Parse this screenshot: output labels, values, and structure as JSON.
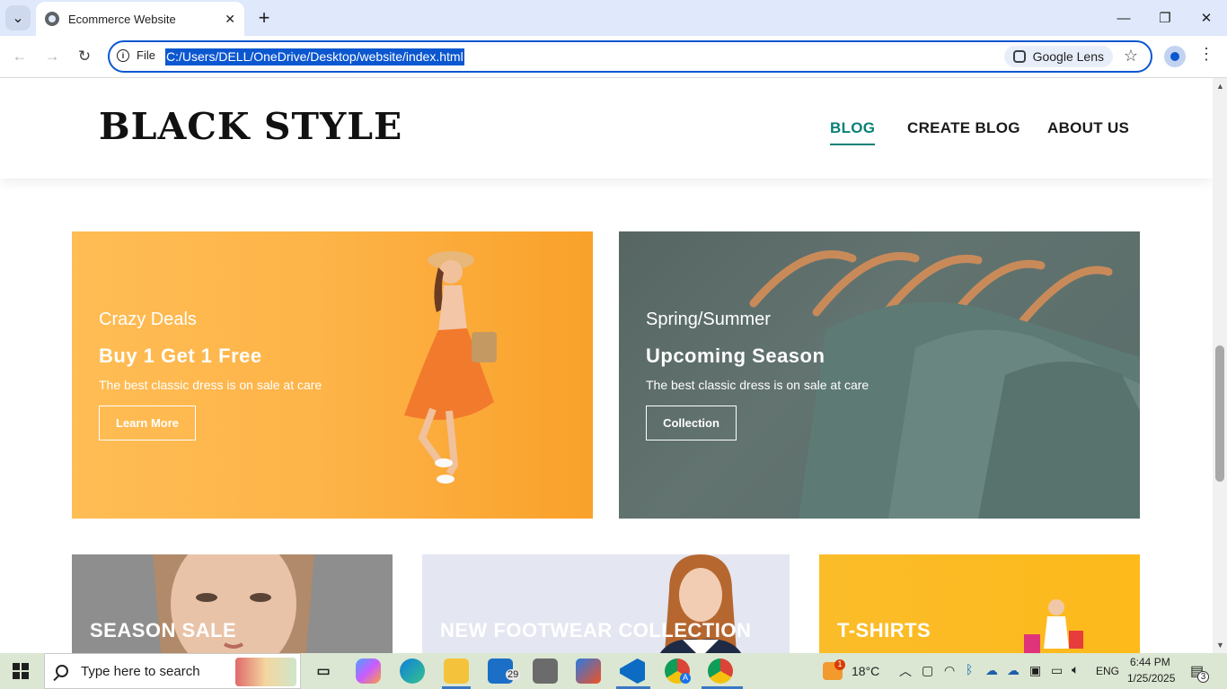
{
  "browser": {
    "tab_title": "Ecommerce Website",
    "url": "C:/Users/DELL/OneDrive/Desktop/website/index.html",
    "site_info_label": "File",
    "lens_label": "Google Lens",
    "close_tab_glyph": "✕",
    "new_tab_glyph": "+",
    "minimize_glyph": "—",
    "restore_glyph": "❐",
    "close_window_glyph": "✕",
    "back_glyph": "←",
    "forward_glyph": "→",
    "reload_glyph": "↻",
    "star_glyph": "☆",
    "menu_glyph": "⋮",
    "tab_list_glyph": "⌄"
  },
  "site": {
    "logo": "BLACK STYLE",
    "nav": [
      {
        "label": "BLOG",
        "active": true
      },
      {
        "label": "CREATE BLOG",
        "active": false
      },
      {
        "label": "ABOUT US",
        "active": false
      }
    ],
    "accent_color": "#088178"
  },
  "banners": [
    {
      "kicker": "Crazy Deals",
      "headline": "Buy 1 Get 1 Free",
      "desc": "The best classic dress is on sale at care",
      "button": "Learn More"
    },
    {
      "kicker": "Spring/Summer",
      "headline": "Upcoming Season",
      "desc": "The best classic dress is on sale at care",
      "button": "Collection"
    }
  ],
  "small_banners": [
    {
      "title": "SEASON SALE"
    },
    {
      "title": "NEW FOOTWEAR COLLECTION"
    },
    {
      "title": "T-SHIRTS"
    }
  ],
  "taskbar": {
    "search_placeholder": "Type here to search",
    "mail_badge": "29",
    "weather_badge": "1",
    "temperature": "18°C",
    "language": "ENG",
    "time": "6:44 PM",
    "date": "1/25/2025",
    "notification_count": "3",
    "chrome_profile_badge": "A"
  }
}
